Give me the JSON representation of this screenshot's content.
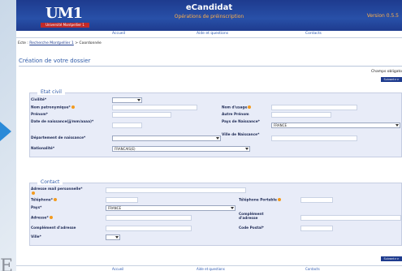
{
  "header": {
    "logo_text": "UM1",
    "logo_sub": "Université Montpellier 1",
    "app_title": "eCandidat",
    "app_subtitle": "Opérations de préinscription",
    "version": "Version 0.5.5"
  },
  "nav": {
    "accueil": "Accueil",
    "aide": "Aide et questions",
    "contacts": "Contacts"
  },
  "breadcrumb": {
    "prefix": "Ecte :",
    "link": "Recherche Montpellier 1",
    "separator": ">",
    "current": "Coordonnée"
  },
  "page_title": "Création de votre dossier",
  "required_note": "Champs obligato",
  "next_label": "Suivant>>",
  "etat_civil": {
    "legend": "Etat civil",
    "civilite_label": "Civilité*",
    "nom_label": "Nom patronymique*",
    "nom_usage_label": "Nom d'usage",
    "prenom_label": "Prénom*",
    "autre_prenom_label": "Autre Prénom",
    "date_label": "Date de naissance(jj/mm/aaaa)*",
    "pays_label": "Pays de Naissance*",
    "pays_value": "FRANCE",
    "departement_label": "Département de naissance*",
    "ville_label": "Ville de Naissance*",
    "nationalite_label": "Nationalité*",
    "nationalite_value": "FRANCAIS(E)"
  },
  "contact": {
    "legend": "Contact",
    "email_label": "Adresse mail personnelle*",
    "telephone_label": "Téléphone*",
    "portable_label": "Téléphone Portable",
    "pays_label": "Pays*",
    "pays_value": "FRANCE",
    "adresse_label": "Adresse*",
    "complement_label": "Complément d'adresse",
    "complement2_label": "Complément d'adresse",
    "code_postal_label": "Code Postal*",
    "ville_label": "Ville*"
  },
  "footer": {
    "accueil": "Accueil",
    "aide": "Aide et questions",
    "contacts": "Contacts"
  },
  "background_letter": "E"
}
